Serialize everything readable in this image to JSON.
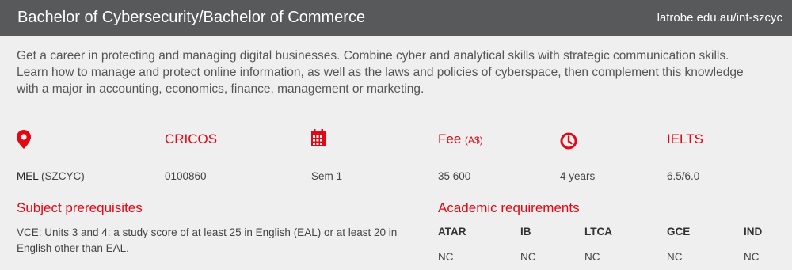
{
  "header": {
    "title": "Bachelor of Cybersecurity/Bachelor of Commerce",
    "url": "latrobe.edu.au/int-szcyc"
  },
  "description": "Get a career in protecting and managing digital businesses. Combine cyber and analytical skills with strategic communication skills. Learn how to manage and protect online information, as well as the laws and policies of cyberspace, then complement this knowledge with a major in accounting, economics, finance, management or marketing.",
  "colors": {
    "accent": "#e30613",
    "header_bg": "#58595b",
    "body_bg": "#efeff0"
  },
  "icons": {
    "location": "map-pin-icon",
    "intake": "calendar-icon",
    "duration": "clock-icon"
  },
  "facts": {
    "location_campus": "MEL",
    "location_code": "(SZCYC)",
    "cricos_label": "CRICOS",
    "cricos_value": "0100860",
    "intake_value": "Sem 1",
    "fee_label": "Fee",
    "fee_unit": "(A$)",
    "fee_value": "35 600",
    "duration_value": "4 years",
    "ielts_label": "IELTS",
    "ielts_value": "6.5/6.0"
  },
  "prerequisites": {
    "heading": "Subject prerequisites",
    "text": "VCE: Units 3 and 4: a study score of at least 25 in English (EAL) or at least 20 in English other than EAL."
  },
  "academic": {
    "heading": "Academic requirements",
    "columns": [
      {
        "label": "ATAR",
        "value": "NC"
      },
      {
        "label": "IB",
        "value": "NC"
      },
      {
        "label": "LTCA",
        "value": "NC"
      },
      {
        "label": "GCE",
        "value": "NC"
      },
      {
        "label": "IND",
        "value": "NC"
      }
    ]
  }
}
